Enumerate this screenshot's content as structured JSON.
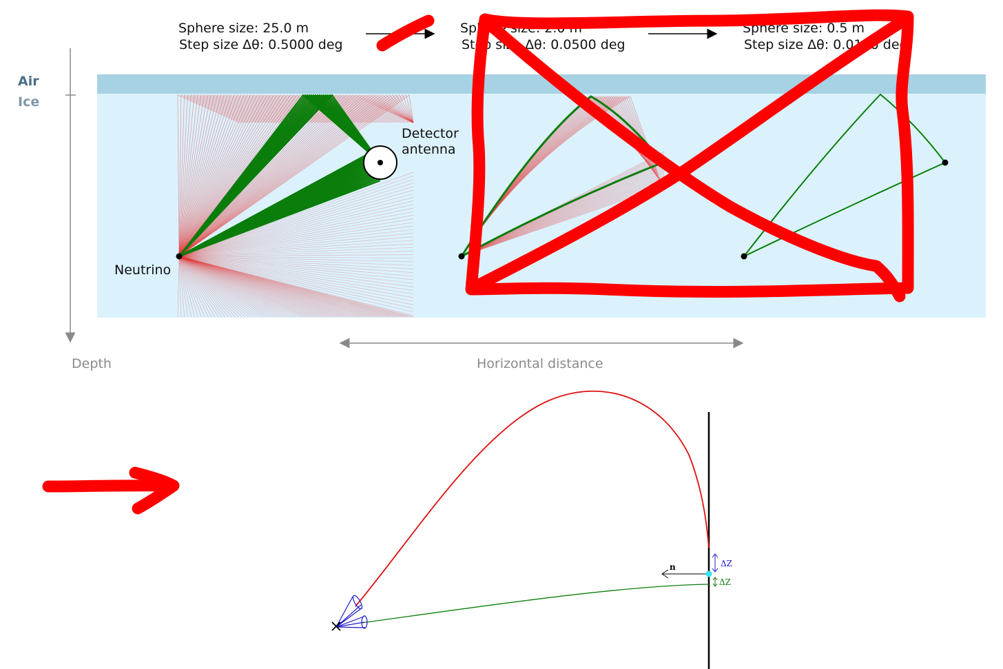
{
  "top_panel": {
    "medium_labels": {
      "air": "Air",
      "ice": "Ice"
    },
    "depth_label": "Depth",
    "horizontal_label": "Horizontal distance",
    "steps": [
      {
        "sphere_label": "Sphere size: 25.0 m",
        "step_label": "Step size Δθ: 0.5000 deg"
      },
      {
        "sphere_label": "Sphere size: 2.0 m",
        "step_label": "Step size Δθ: 0.0500 deg"
      },
      {
        "sphere_label": "Sphere size: 0.5 m",
        "step_label": "Step size Δθ: 0.0100 deg"
      }
    ],
    "neutrino_label": "Neutrino",
    "detector_label_line1": "Detector",
    "detector_label_line2": "antenna"
  },
  "bottom_panel": {
    "normal_label": "n",
    "delta_z_blue": "ΔZ",
    "delta_z_green": "ΔZ"
  },
  "colors": {
    "air": "#a6d2e3",
    "ice": "#dbf2fd",
    "ray_green": "#0a7d0a",
    "ray_red": "#e23a3a",
    "markup_red": "#ff0000",
    "cone_blue": "#1a1acc",
    "marker_cyan": "#33e6f0"
  },
  "icons": [
    "arrow-right-icon",
    "cross-out-marker",
    "neutrino-x-marker"
  ]
}
